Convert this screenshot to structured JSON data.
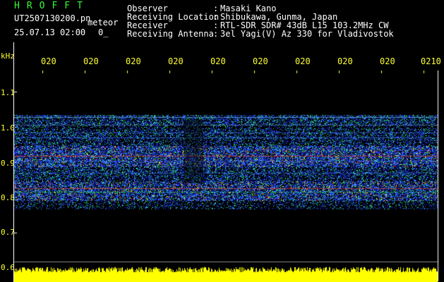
{
  "header": {
    "brand": "HROFFT",
    "filename": "UT2507130200.pn",
    "kind": "meteor",
    "datetime": "25.07.13 02:00",
    "sub": "0_",
    "meta": [
      {
        "key": "Observer",
        "sep": ":",
        "value": "Masaki Kano"
      },
      {
        "key": "Receiving Location",
        "sep": ":",
        "value": "Shibukawa, Gunma, Japan"
      },
      {
        "key": "Receiver",
        "sep": ":",
        "value": "RTL-SDR SDR# 43dB L15 103.2MHz CW"
      },
      {
        "key": "Receiving Antenna",
        "sep": ":",
        "value": "3el Yagi(V) Az 330 for Vladivostok"
      }
    ]
  },
  "plot": {
    "unit": "kHz",
    "x_ticks": [
      "020",
      "020",
      "020",
      "020",
      "020",
      "020",
      "020",
      "020",
      "020",
      "0210"
    ],
    "y_ticks": [
      "1.1",
      "1.0",
      "0.9",
      "0.8",
      "0.7",
      "0.6"
    ]
  },
  "colors": {
    "background": "#000000",
    "label": "#ffff33",
    "brand": "#33ff33",
    "noise": "#ffff00",
    "text": "#ffffff"
  }
}
